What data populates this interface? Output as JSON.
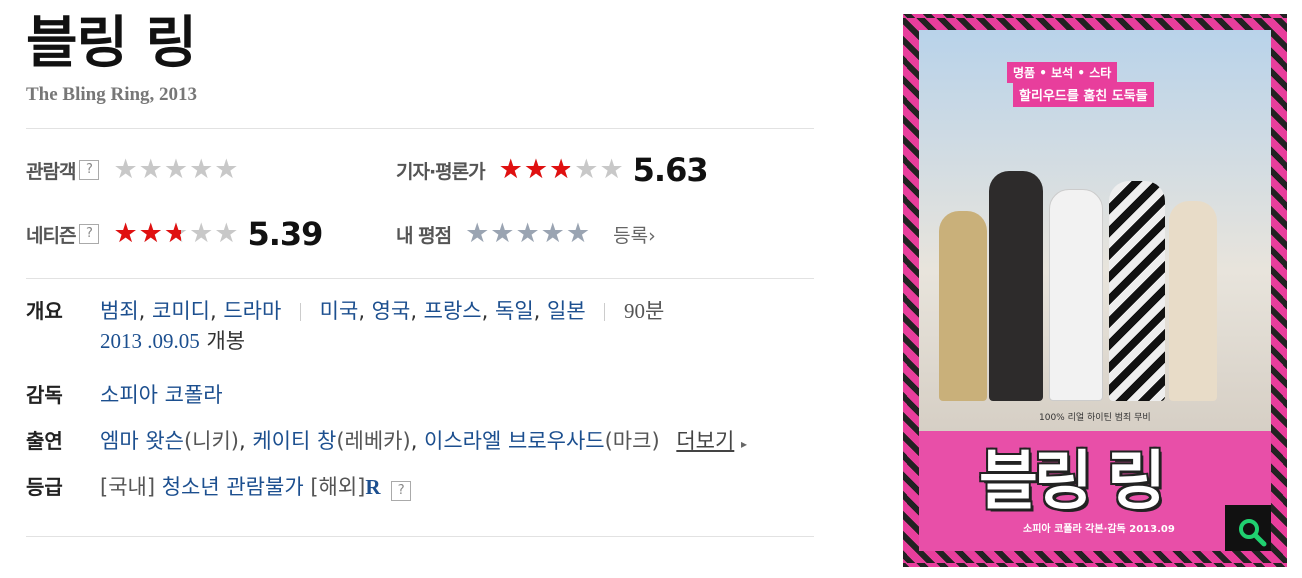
{
  "movie": {
    "title": "블링 링",
    "subtitle": "The Bling Ring, 2013"
  },
  "ratings": {
    "audience": {
      "label": "관람객",
      "help": "?",
      "value": 0,
      "max": 5
    },
    "critic": {
      "label": "기자·평론가",
      "value": 5.63,
      "score_text": "5.63",
      "max": 10
    },
    "netizen": {
      "label": "네티즌",
      "help": "?",
      "value": 5.39,
      "score_text": "5.39",
      "max": 10
    },
    "mine": {
      "label": "내 평점",
      "register": "등록",
      "register_arrow": "›"
    }
  },
  "details": {
    "overview": {
      "label": "개요",
      "genres": [
        "범죄",
        "코미디",
        "드라마"
      ],
      "countries": [
        "미국",
        "영국",
        "프랑스",
        "독일",
        "일본"
      ],
      "runtime": "90분",
      "release_date": "2013 .09.05",
      "release_suffix": "개봉"
    },
    "director": {
      "label": "감독",
      "name": "소피아 코폴라"
    },
    "cast": {
      "label": "출연",
      "actors": [
        {
          "name": "엠마 왓슨",
          "role": "(니키)"
        },
        {
          "name": "케이티 창",
          "role": "(레베카)"
        },
        {
          "name": "이스라엘 브로우사드",
          "role": "(마크)"
        }
      ],
      "more": "더보기",
      "more_arrow": "▸"
    },
    "grade": {
      "label": "등급",
      "domestic_prefix": "[국내]",
      "domestic": "청소년 관람불가",
      "overseas_prefix": "[해외]",
      "overseas": "R",
      "help": "?"
    }
  },
  "poster": {
    "tagline_top": "명품 • 보석 • 스타",
    "tagline": "할리우드를 훔친 도둑들",
    "caption": "100% 리얼 하이틴 범죄 무비",
    "title": "블링 링",
    "bottom": "소피아 코폴라 각본·감독 2013.09",
    "zoom_icon": "search-icon"
  },
  "colors": {
    "star_on": "#e01010",
    "star_off": "#c8c8c8",
    "link": "#1c4f8f",
    "poster_pink": "#e83e9c"
  }
}
